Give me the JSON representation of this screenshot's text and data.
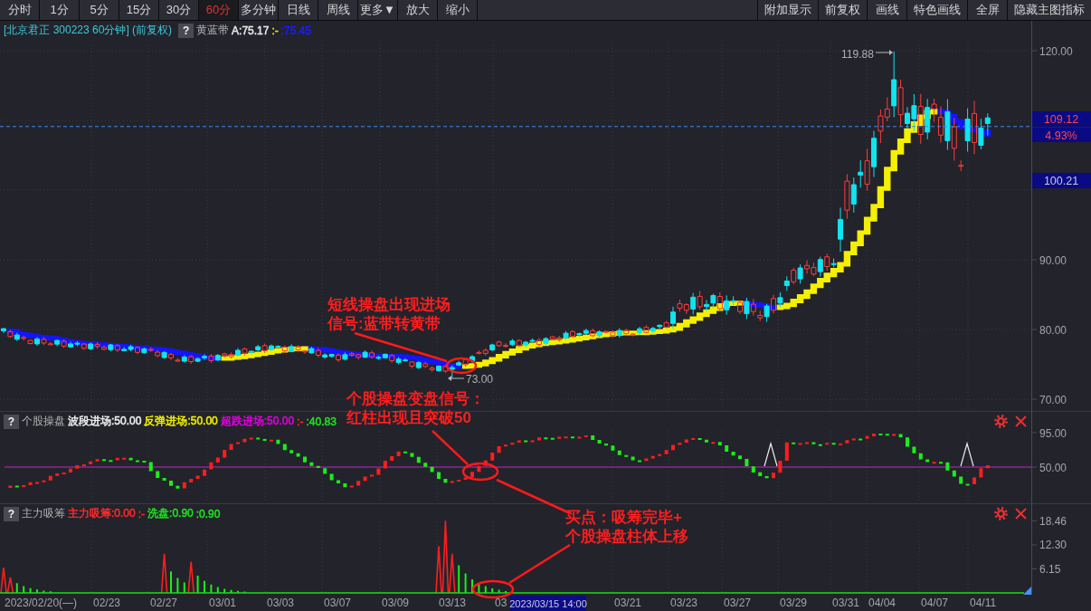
{
  "toolbar": {
    "left": [
      {
        "label": "分时",
        "selected": false
      },
      {
        "label": "1分",
        "selected": false
      },
      {
        "label": "5分",
        "selected": false
      },
      {
        "label": "15分",
        "selected": false
      },
      {
        "label": "30分",
        "selected": false
      },
      {
        "label": "60分",
        "selected": true
      },
      {
        "label": "多分钟",
        "selected": false
      },
      {
        "label": "日线",
        "selected": false
      },
      {
        "label": "周线",
        "selected": false
      },
      {
        "label": "更多▼",
        "selected": false
      },
      {
        "label": "放大",
        "selected": false
      },
      {
        "label": "缩小",
        "selected": false
      }
    ],
    "right": [
      {
        "label": "附加显示"
      },
      {
        "label": "前复权"
      },
      {
        "label": "画线"
      },
      {
        "label": "特色画线"
      },
      {
        "label": "全屏"
      },
      {
        "label": "隐藏主图指标"
      }
    ]
  },
  "main_chart": {
    "title": "[北京君正 300223 60分钟] (前复权)",
    "help": "?",
    "indicator": "黄蓝带",
    "values": [
      {
        "text": "A:75.17",
        "color": "#e8e8e8"
      },
      {
        "text": ":-",
        "color": "#e8e800"
      },
      {
        "text": ":75.45",
        "color": "#1c1cff"
      }
    ],
    "y_axis": [
      "120.00",
      "90.00",
      "80.00",
      "70.00"
    ],
    "last_price": "109.12",
    "change": "4.93%",
    "cursor_price": "100.21",
    "high_label": "119.88",
    "low_label": "73.00"
  },
  "indicator_1": {
    "help": "?",
    "name": "个股操盘",
    "values": [
      {
        "text": "波段进场:50.00",
        "color": "#f0f0f0"
      },
      {
        "text": "反弹进场:50.00",
        "color": "#f0f000"
      },
      {
        "text": "超跌进场:50.00",
        "color": "#e000e0"
      },
      {
        "text": ":-",
        "color": "#ff2a2a"
      },
      {
        "text": ":40.83",
        "color": "#20e020"
      }
    ],
    "y_axis": [
      "95.00",
      "50.00"
    ]
  },
  "indicator_2": {
    "help": "?",
    "name": "主力吸筹",
    "values": [
      {
        "text": "主力吸筹:0.00",
        "color": "#ff2a2a"
      },
      {
        "text": ":-",
        "color": "#ff2a2a"
      },
      {
        "text": "洗盘:0.90",
        "color": "#20e020"
      },
      {
        "text": ":0.90",
        "color": "#20e020"
      }
    ],
    "y_axis": [
      "18.46",
      "12.30",
      "6.15"
    ]
  },
  "date_axis": {
    "labels": [
      "2023/02/20(—)",
      "02/23",
      "02/27",
      "03/01",
      "03/03",
      "03/07",
      "03/09",
      "03/13",
      "03",
      "03/21",
      "03/23",
      "03/27",
      "03/29",
      "03/31",
      "04/04",
      "04/07",
      "04/11"
    ],
    "cursor_label": "2023/03/15 14:00"
  },
  "annotations": [
    {
      "lines": [
        "短线操盘出现进场",
        "信号:蓝带转黄带"
      ]
    },
    {
      "lines": [
        "个股操盘变盘信号：",
        "红柱出现且突破50"
      ]
    },
    {
      "lines": [
        "买点：吸筹完毕+",
        "个股操盘柱体上移"
      ]
    }
  ]
}
